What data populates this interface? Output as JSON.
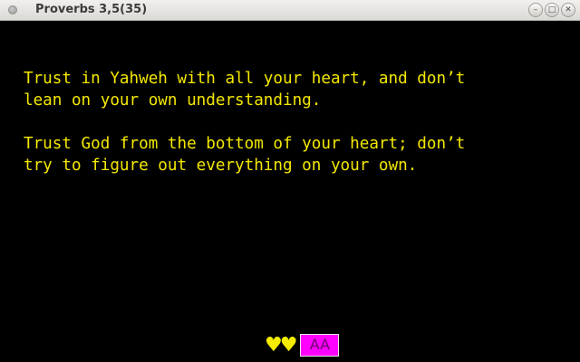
{
  "window": {
    "title": "Proverbs 3,5(35)",
    "controls": {
      "minimize_glyph": "–",
      "maximize_glyph": "□",
      "close_glyph": "✕"
    }
  },
  "verses": [
    "Trust in Yahweh with all your heart, and don’t\nlean on your own understanding.",
    "Trust God from the bottom of your heart; don’t\ntry to figure out everything on your own."
  ],
  "footer": {
    "hearts": "♥♥",
    "font_button_label": "AA"
  },
  "colors": {
    "background": "#000000",
    "verse_text": "#f4e800",
    "hearts": "#f4ec00",
    "font_button_bg": "#ff00ff"
  }
}
